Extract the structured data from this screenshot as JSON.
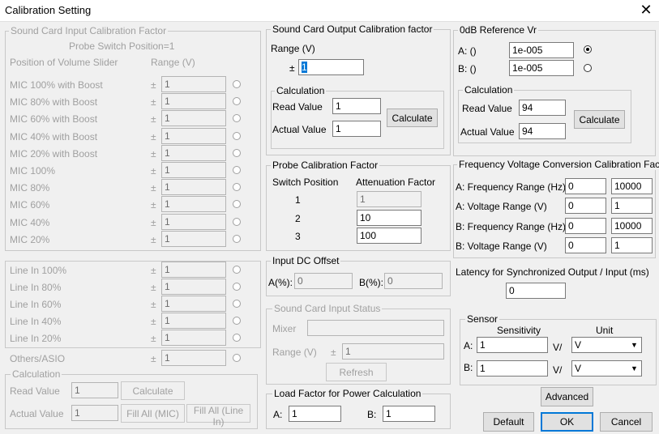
{
  "window": {
    "title": "Calibration Setting"
  },
  "input_cal": {
    "legend": "Sound Card Input Calibration Factor",
    "probe_switch": "Probe Switch Position=1",
    "col_position": "Position of Volume Slider",
    "col_range": "Range (V)",
    "plus_minus": "±",
    "mic_rows": [
      {
        "label": "MIC 100% with Boost",
        "value": "1"
      },
      {
        "label": "MIC 80% with Boost",
        "value": "1"
      },
      {
        "label": "MIC 60% with Boost",
        "value": "1"
      },
      {
        "label": "MIC 40% with Boost",
        "value": "1"
      },
      {
        "label": "MIC 20% with Boost",
        "value": "1"
      },
      {
        "label": "MIC 100%",
        "value": "1"
      },
      {
        "label": "MIC 80%",
        "value": "1"
      },
      {
        "label": "MIC 60%",
        "value": "1"
      },
      {
        "label": "MIC 40%",
        "value": "1"
      },
      {
        "label": "MIC 20%",
        "value": "1"
      }
    ],
    "line_rows": [
      {
        "label": "Line In 100%",
        "value": "1"
      },
      {
        "label": "Line In 80%",
        "value": "1"
      },
      {
        "label": "Line In 60%",
        "value": "1"
      },
      {
        "label": "Line In 40%",
        "value": "1"
      },
      {
        "label": "Line In 20%",
        "value": "1"
      }
    ],
    "others": {
      "label": "Others/ASIO",
      "value": "1"
    },
    "calc": {
      "legend": "Calculation",
      "read_label": "Read Value",
      "read_value": "1",
      "actual_label": "Actual Value",
      "actual_value": "1",
      "calculate": "Calculate",
      "fill_mic": "Fill All (MIC)",
      "fill_line": "Fill All (Line In)"
    }
  },
  "output_cal": {
    "legend": "Sound Card Output Calibration factor",
    "range_label": "Range (V)",
    "plus_minus": "±",
    "range_value": "1",
    "calc": {
      "legend": "Calculation",
      "read_label": "Read Value",
      "read_value": "1",
      "actual_label": "Actual Value",
      "actual_value": "1",
      "calculate": "Calculate"
    }
  },
  "probe_cal": {
    "legend": "Probe Calibration Factor",
    "col_switch": "Switch Position",
    "col_atten": "Attenuation Factor",
    "rows": [
      {
        "pos": "1",
        "value": "1"
      },
      {
        "pos": "2",
        "value": "10"
      },
      {
        "pos": "3",
        "value": "100"
      }
    ]
  },
  "dc_offset": {
    "legend": "Input DC Offset",
    "a_label": "A(%):",
    "a_value": "0",
    "b_label": "B(%):",
    "b_value": "0"
  },
  "input_status": {
    "legend": "Sound Card Input Status",
    "mixer_label": "Mixer",
    "mixer_value": "",
    "range_label": "Range (V)",
    "plus_minus": "±",
    "range_value": "1",
    "refresh": "Refresh"
  },
  "load_factor": {
    "legend": "Load Factor for Power Calculation",
    "a_label": "A:",
    "a_value": "1",
    "b_label": "B:",
    "b_value": "1"
  },
  "zero_db": {
    "legend": "0dB Reference Vr",
    "a_label": "A: ()",
    "a_value": "1e-005",
    "b_label": "B: ()",
    "b_value": "1e-005",
    "calc": {
      "legend": "Calculation",
      "read_label": "Read Value",
      "read_value": "94",
      "actual_label": "Actual Value",
      "actual_value": "94",
      "calculate": "Calculate"
    }
  },
  "freq_volt": {
    "legend": "Frequency Voltage Conversion Calibration Factor",
    "rows": [
      {
        "label": "A: Frequency Range (Hz)",
        "v1": "0",
        "v2": "10000"
      },
      {
        "label": "A: Voltage Range (V)",
        "v1": "0",
        "v2": "1"
      },
      {
        "label": "B: Frequency Range (Hz)",
        "v1": "0",
        "v2": "10000"
      },
      {
        "label": "B: Voltage Range (V)",
        "v1": "0",
        "v2": "1"
      }
    ]
  },
  "latency": {
    "label": "Latency for Synchronized Output / Input (ms)",
    "value": "0"
  },
  "sensor": {
    "legend": "Sensor",
    "col_sensitivity": "Sensitivity",
    "col_unit": "Unit",
    "a_label": "A:",
    "a_value": "1",
    "a_sep": "V/",
    "a_unit": "V",
    "b_label": "B:",
    "b_value": "1",
    "b_sep": "V/",
    "b_unit": "V"
  },
  "buttons": {
    "advanced": "Advanced",
    "default": "Default",
    "ok": "OK",
    "cancel": "Cancel"
  }
}
